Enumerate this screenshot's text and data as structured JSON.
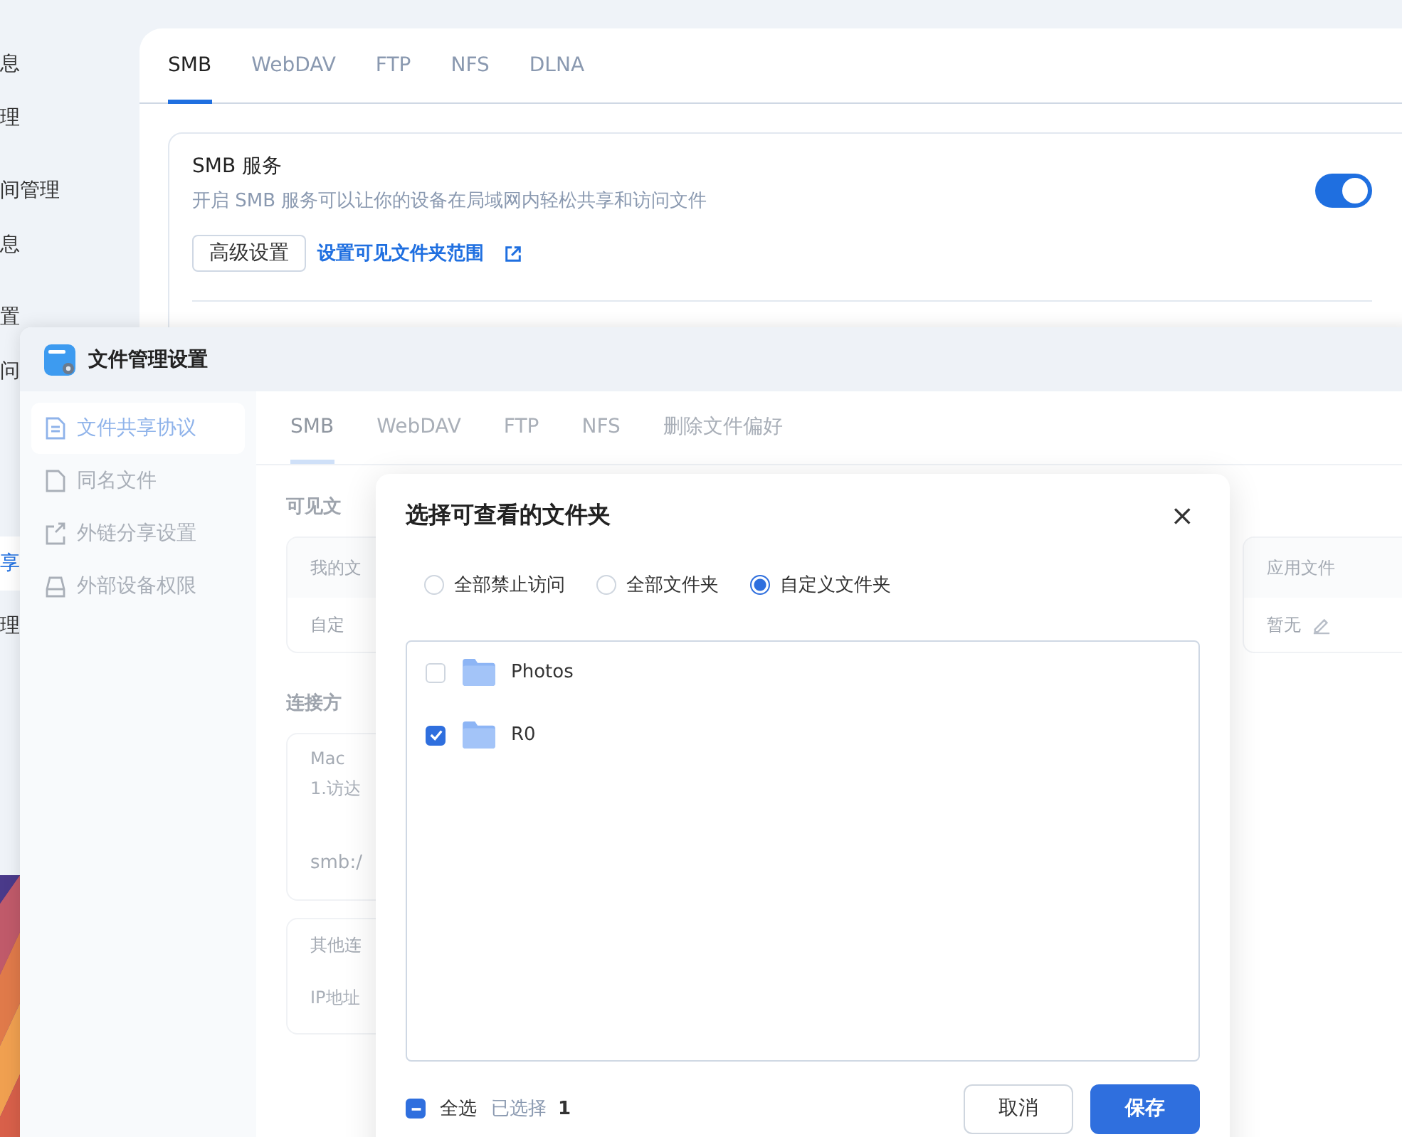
{
  "back_window": {
    "sidebar": [
      {
        "label": "息",
        "selected": false
      },
      {
        "label": "理",
        "selected": false
      },
      {
        "label": "间管理",
        "selected": false
      },
      {
        "label": "息",
        "selected": false
      },
      {
        "label": "置",
        "selected": false
      },
      {
        "label": "问",
        "selected": false
      },
      {
        "label": "享",
        "selected": true
      },
      {
        "label": "理",
        "selected": false
      }
    ],
    "tabs": [
      {
        "label": "SMB",
        "selected": true
      },
      {
        "label": "WebDAV",
        "selected": false
      },
      {
        "label": "FTP",
        "selected": false
      },
      {
        "label": "NFS",
        "selected": false
      },
      {
        "label": "DLNA",
        "selected": false
      }
    ],
    "smb_service": {
      "title": "SMB 服务",
      "description": "开启 SMB 服务可以让你的设备在局域网内轻松共享和访问文件",
      "advanced_button": "高级设置",
      "folder_link": "设置可见文件夹范围",
      "enabled": true
    }
  },
  "file_settings_window": {
    "title": "文件管理设置",
    "sidebar": [
      {
        "label": "文件共享协议",
        "selected": true
      },
      {
        "label": "同名文件",
        "selected": false
      },
      {
        "label": "外链分享设置",
        "selected": false
      },
      {
        "label": "外部设备权限",
        "selected": false
      }
    ],
    "tabs": [
      {
        "label": "SMB",
        "selected": true
      },
      {
        "label": "WebDAV",
        "selected": false
      },
      {
        "label": "FTP",
        "selected": false
      },
      {
        "label": "NFS",
        "selected": false
      },
      {
        "label": "删除文件偏好",
        "selected": false
      }
    ],
    "visible_folders": {
      "heading": "可见文",
      "my_files": {
        "header": "我的文",
        "value": "自定"
      },
      "app_files": {
        "header": "应用文件",
        "value": "暂无"
      }
    },
    "connection": {
      "heading": "连接方",
      "mac": {
        "title": "Mac",
        "step": "1.访达",
        "address": "smb:/"
      },
      "other": {
        "title": "其他连",
        "address": "IP地址"
      }
    }
  },
  "dialog": {
    "title": "选择可查看的文件夹",
    "close": "×",
    "access_options": [
      {
        "label": "全部禁止访问",
        "selected": false
      },
      {
        "label": "全部文件夹",
        "selected": false
      },
      {
        "label": "自定义文件夹",
        "selected": true
      }
    ],
    "folders": [
      {
        "name": "Photos",
        "checked": false
      },
      {
        "name": "R0",
        "checked": true
      }
    ],
    "select_all": {
      "label": "全选",
      "indeterminate": true
    },
    "selected_label": "已选择",
    "selected_count": "1",
    "buttons": [
      {
        "label": "取消",
        "kind": "secondary"
      },
      {
        "label": "保存",
        "kind": "primary"
      }
    ]
  }
}
